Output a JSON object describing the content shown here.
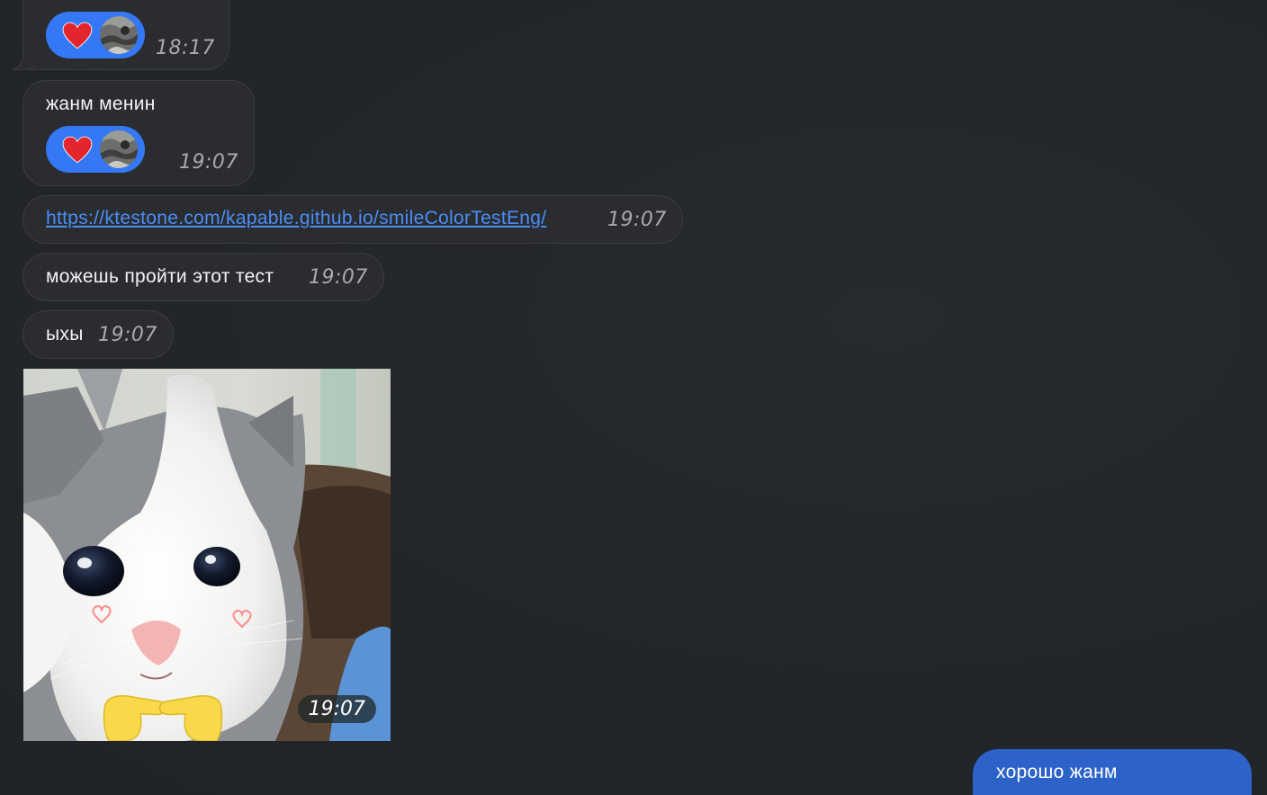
{
  "messages": [
    {
      "time": "18:17",
      "reaction": {
        "emoji": "heart",
        "color": "#3478f6"
      }
    },
    {
      "text": "жанм менин",
      "time": "19:07",
      "reaction": {
        "emoji": "heart",
        "color": "#3478f6"
      }
    },
    {
      "link": "https://ktestone.com/kapable.github.io/smileColorTestEng/",
      "time": "19:07"
    },
    {
      "text": "можешь пройти этот тест",
      "time": "19:07"
    },
    {
      "text": "ыхы",
      "time": "19:07"
    },
    {
      "image": "crying-kitten-sticker",
      "time": "19:07"
    }
  ],
  "outgoing": {
    "text": "хорошо жанм"
  },
  "colors": {
    "background": "#22262a",
    "incoming_bubble": "#2a2c2f",
    "outgoing_bubble": "#2d63c9",
    "link": "#4a8ef8",
    "reaction_pill": "#3478f6"
  }
}
